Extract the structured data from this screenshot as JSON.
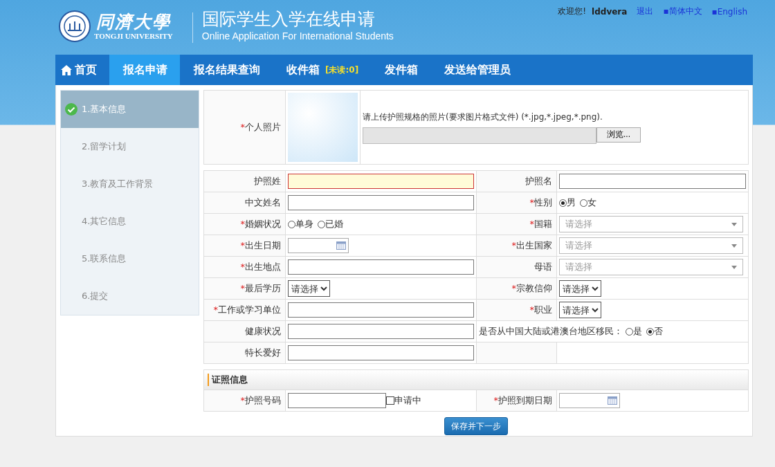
{
  "header": {
    "logo_text": "同濟大學",
    "logo_subtext": "TONGJI UNIVERSITY",
    "title": "国际学生入学在线申请",
    "subtitle": "Online Application For International Students"
  },
  "user_bar": {
    "greeting": "欢迎您!",
    "username": "lddvera",
    "links": [
      "退出",
      "▪简体中文",
      "▪English"
    ]
  },
  "nav": [
    {
      "label": "首页",
      "kind": "home",
      "selected": false
    },
    {
      "label": "报名申请",
      "kind": "plain",
      "selected": true
    },
    {
      "label": "报名结果查询",
      "kind": "plain",
      "selected": false
    },
    {
      "label": "收件箱",
      "kind": "plain",
      "selected": false,
      "badge": "[未读:0]"
    },
    {
      "label": "发件箱",
      "kind": "plain",
      "selected": false
    },
    {
      "label": "发送给管理员",
      "kind": "plain",
      "selected": false
    }
  ],
  "steps": [
    {
      "label": "1.基本信息",
      "selected": true,
      "completed": true
    },
    {
      "label": "2.留学计划",
      "selected": false,
      "completed": false
    },
    {
      "label": "3.教育及工作背景",
      "selected": false,
      "completed": false
    },
    {
      "label": "4.其它信息",
      "selected": false,
      "completed": false
    },
    {
      "label": "5.联系信息",
      "selected": false,
      "completed": false
    },
    {
      "label": "6.提交",
      "selected": false,
      "completed": false
    }
  ],
  "photo_row": {
    "label": "个人照片",
    "required_mark": "*",
    "instructions": "请上传护照规格的照片(要求图片格式文件) (*.jpg,*.jpeg,*.png).",
    "browse_button": "浏览..."
  },
  "rows": [
    {
      "cells": [
        {
          "label": "护照姓",
          "field": {
            "kind": "text",
            "highlighted": true
          }
        },
        {
          "label": "护照名",
          "field": {
            "kind": "text",
            "highlighted": false
          }
        }
      ]
    },
    {
      "cells": [
        {
          "label": "中文姓名",
          "field": {
            "kind": "text",
            "highlighted": false
          }
        },
        {
          "label": "性别",
          "required_mark": "*",
          "field": {
            "kind": "radio",
            "options": [
              {
                "label": "男",
                "selected": true
              },
              {
                "label": "女",
                "selected": false
              }
            ]
          }
        }
      ]
    },
    {
      "cells": [
        {
          "label": "婚姻状况",
          "required_mark": "*",
          "field": {
            "kind": "radio",
            "options": [
              {
                "label": "单身",
                "selected": false
              },
              {
                "label": "已婚",
                "selected": false
              }
            ]
          }
        },
        {
          "label": "国籍",
          "required_mark": "*",
          "field": {
            "kind": "combo",
            "placeholder": "请选择"
          }
        }
      ]
    },
    {
      "cells": [
        {
          "label": "出生日期",
          "required_mark": "*",
          "field": {
            "kind": "date"
          }
        },
        {
          "label": "出生国家",
          "required_mark": "*",
          "field": {
            "kind": "combo",
            "placeholder": "请选择"
          }
        }
      ]
    },
    {
      "cells": [
        {
          "label": "出生地点",
          "required_mark": "*",
          "field": {
            "kind": "text",
            "highlighted": false
          }
        },
        {
          "label": "母语",
          "field": {
            "kind": "combo",
            "placeholder": "请选择"
          }
        }
      ]
    },
    {
      "cells": [
        {
          "label": "最后学历",
          "required_mark": "*",
          "field": {
            "kind": "select",
            "value": "请选择"
          }
        },
        {
          "label": "宗教信仰",
          "required_mark": "*",
          "field": {
            "kind": "select",
            "value": "请选择"
          }
        }
      ]
    },
    {
      "cells": [
        {
          "label": "工作或学习单位",
          "required_mark": "*",
          "field": {
            "kind": "text",
            "highlighted": false
          }
        },
        {
          "label": "职业",
          "required_mark": "*",
          "field": {
            "kind": "select",
            "value": "请选择"
          }
        }
      ]
    },
    {
      "cells": [
        {
          "label": "健康状况",
          "field": {
            "kind": "text",
            "highlighted": false
          }
        },
        {
          "kind": "inline",
          "text": "是否从中国大陆或港澳台地区移民：",
          "options": [
            {
              "label": "是",
              "selected": false
            },
            {
              "label": "否",
              "selected": true
            }
          ]
        }
      ]
    },
    {
      "cells": [
        {
          "label": "特长爱好",
          "field": {
            "kind": "text",
            "highlighted": false
          }
        },
        {
          "kind": "empty"
        }
      ]
    }
  ],
  "section": {
    "title": "证照信息",
    "rows": [
      {
        "cells": [
          {
            "label": "护照号码",
            "required_mark": "*",
            "field": {
              "kind": "text",
              "highlighted": false,
              "checkbox": {
                "label": "申请中",
                "checked": false
              }
            }
          },
          {
            "label": "护照到期日期",
            "required_mark": "*",
            "field": {
              "kind": "date"
            }
          }
        ]
      }
    ]
  },
  "submit": "保存并下一步"
}
